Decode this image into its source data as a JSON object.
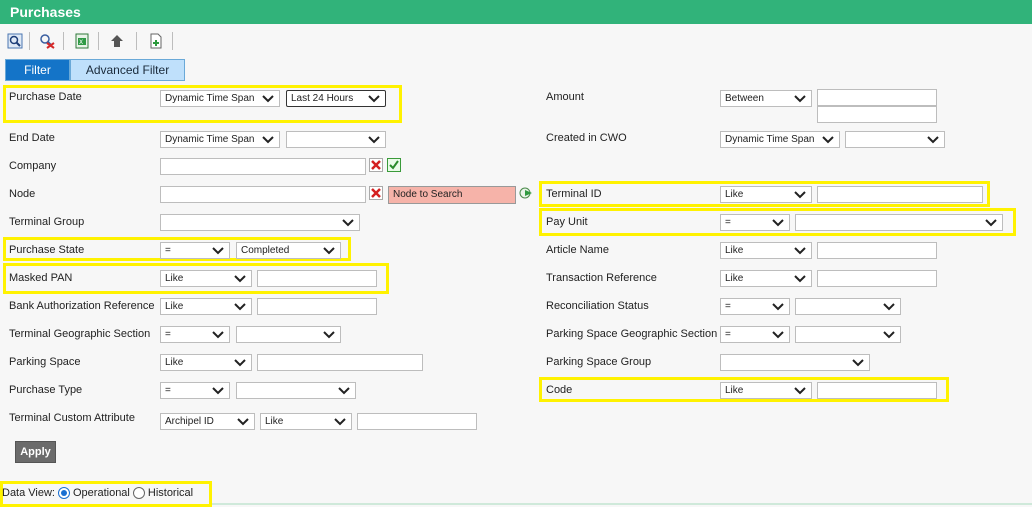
{
  "title": "Purchases",
  "toolbar": {
    "icons": [
      "search-icon",
      "clear-filter-icon",
      "export-excel-icon",
      "back-arrow-icon",
      "new-document-icon"
    ]
  },
  "tabs": {
    "filter": "Filter",
    "advanced": "Advanced Filter"
  },
  "left": {
    "purchase_date": {
      "label": "Purchase Date",
      "mode": "Dynamic Time Span",
      "value": "Last 24 Hours"
    },
    "end_date": {
      "label": "End Date",
      "mode": "Dynamic Time Span",
      "value": ""
    },
    "company": {
      "label": "Company"
    },
    "node": {
      "label": "Node",
      "search_label": "Node to Search"
    },
    "terminal_group": {
      "label": "Terminal Group"
    },
    "purchase_state": {
      "label": "Purchase State",
      "op": "=",
      "value": "Completed"
    },
    "masked_pan": {
      "label": "Masked PAN",
      "op": "Like"
    },
    "bank_auth": {
      "label": "Bank Authorization Reference",
      "op": "Like"
    },
    "terminal_geo": {
      "label": "Terminal Geographic Section",
      "op": "="
    },
    "parking_space": {
      "label": "Parking Space",
      "op": "Like"
    },
    "purchase_type": {
      "label": "Purchase Type",
      "op": "="
    },
    "terminal_custom": {
      "label": "Terminal Custom Attribute",
      "attr": "Archipel ID",
      "op": "Like"
    }
  },
  "right": {
    "amount": {
      "label": "Amount",
      "op": "Between"
    },
    "created_cwo": {
      "label": "Created in CWO",
      "mode": "Dynamic Time Span"
    },
    "terminal_id": {
      "label": "Terminal ID",
      "op": "Like"
    },
    "pay_unit": {
      "label": "Pay Unit",
      "op": "="
    },
    "article_name": {
      "label": "Article Name",
      "op": "Like"
    },
    "transaction_ref": {
      "label": "Transaction Reference",
      "op": "Like"
    },
    "reconciliation": {
      "label": "Reconciliation Status",
      "op": "="
    },
    "parking_geo": {
      "label": "Parking Space Geographic Section",
      "op": "="
    },
    "parking_group": {
      "label": "Parking Space Group"
    },
    "code": {
      "label": "Code",
      "op": "Like"
    }
  },
  "apply_label": "Apply",
  "data_view": {
    "label": "Data View:",
    "options": [
      "Operational",
      "Historical"
    ],
    "selected": "Operational"
  },
  "colors": {
    "header": "#31b37a",
    "highlight": "#fff200",
    "tab_active": "#1474c8",
    "tab_inactive": "#bfe0fb",
    "node_search_bg": "#f6b3a9"
  }
}
